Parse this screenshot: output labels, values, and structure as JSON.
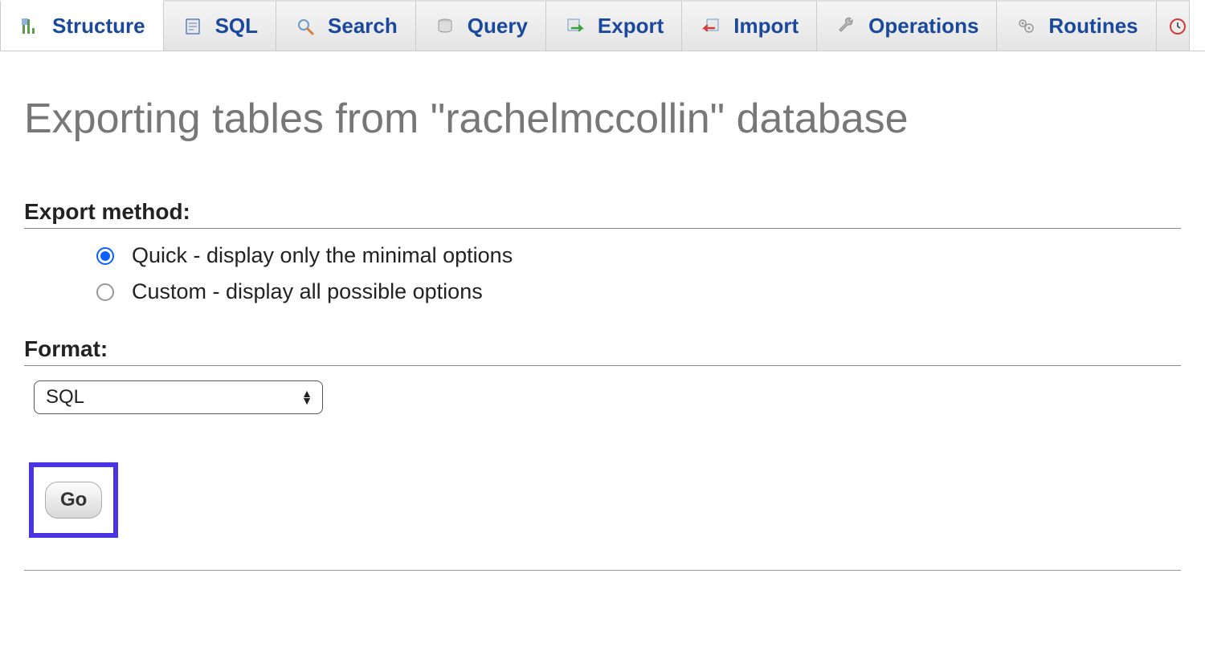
{
  "tabs": [
    {
      "label": "Structure",
      "icon": "structure-icon",
      "active": true
    },
    {
      "label": "SQL",
      "icon": "sql-icon",
      "active": false
    },
    {
      "label": "Search",
      "icon": "search-icon",
      "active": false
    },
    {
      "label": "Query",
      "icon": "query-icon",
      "active": false
    },
    {
      "label": "Export",
      "icon": "export-icon",
      "active": false
    },
    {
      "label": "Import",
      "icon": "import-icon",
      "active": false
    },
    {
      "label": "Operations",
      "icon": "operations-icon",
      "active": false
    },
    {
      "label": "Routines",
      "icon": "routines-icon",
      "active": false
    }
  ],
  "page_title": "Exporting tables from \"rachelmccollin\" database",
  "sections": {
    "export_method_label": "Export method:",
    "format_label": "Format:"
  },
  "radio_options": [
    {
      "label": "Quick - display only the minimal options",
      "selected": true
    },
    {
      "label": "Custom - display all possible options",
      "selected": false
    }
  ],
  "format_select": {
    "value": "SQL"
  },
  "go_button_label": "Go"
}
